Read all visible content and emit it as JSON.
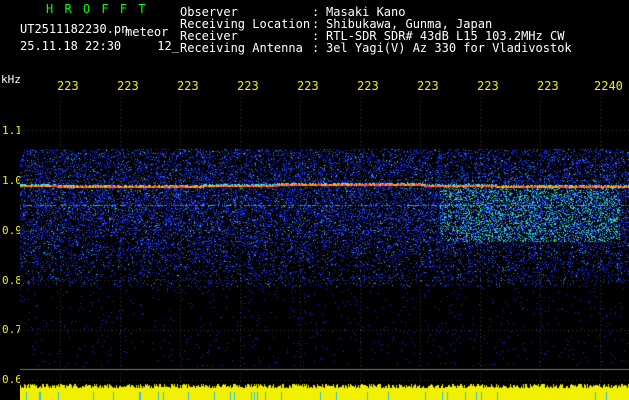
{
  "brand": "HROFFT",
  "file_name": "UT2511182230.pn",
  "file_tag": "meteor",
  "stamp_date": "25.11.18 22:30",
  "stamp_extra": "12_",
  "info": [
    {
      "label": "Observer",
      "sep": ":",
      "value": "Masaki Kano"
    },
    {
      "label": "Receiving Location",
      "sep": ":",
      "value": "Shibukawa, Gunma, Japan"
    },
    {
      "label": "Receiver",
      "sep": ":",
      "value": "RTL-SDR SDR# 43dB L15 103.2MHz CW"
    },
    {
      "label": "Receiving Antenna",
      "sep": ":",
      "value": "3el Yagi(V) Az 330 for Vladivostok"
    }
  ],
  "y_unit": "kHz",
  "y_ticks": [
    "1.1",
    "1.0",
    "0.9",
    "0.8",
    "0.7",
    "0.6"
  ],
  "x_ticks": [
    "223",
    "223",
    "223",
    "223",
    "223",
    "223",
    "223",
    "223",
    "223",
    "2240"
  ],
  "colors": {
    "brand": "#00ff00",
    "tick": "#f0f000",
    "signal": "#ff4040",
    "noise": "#2a40ff",
    "baseline": "#f0f000"
  }
}
